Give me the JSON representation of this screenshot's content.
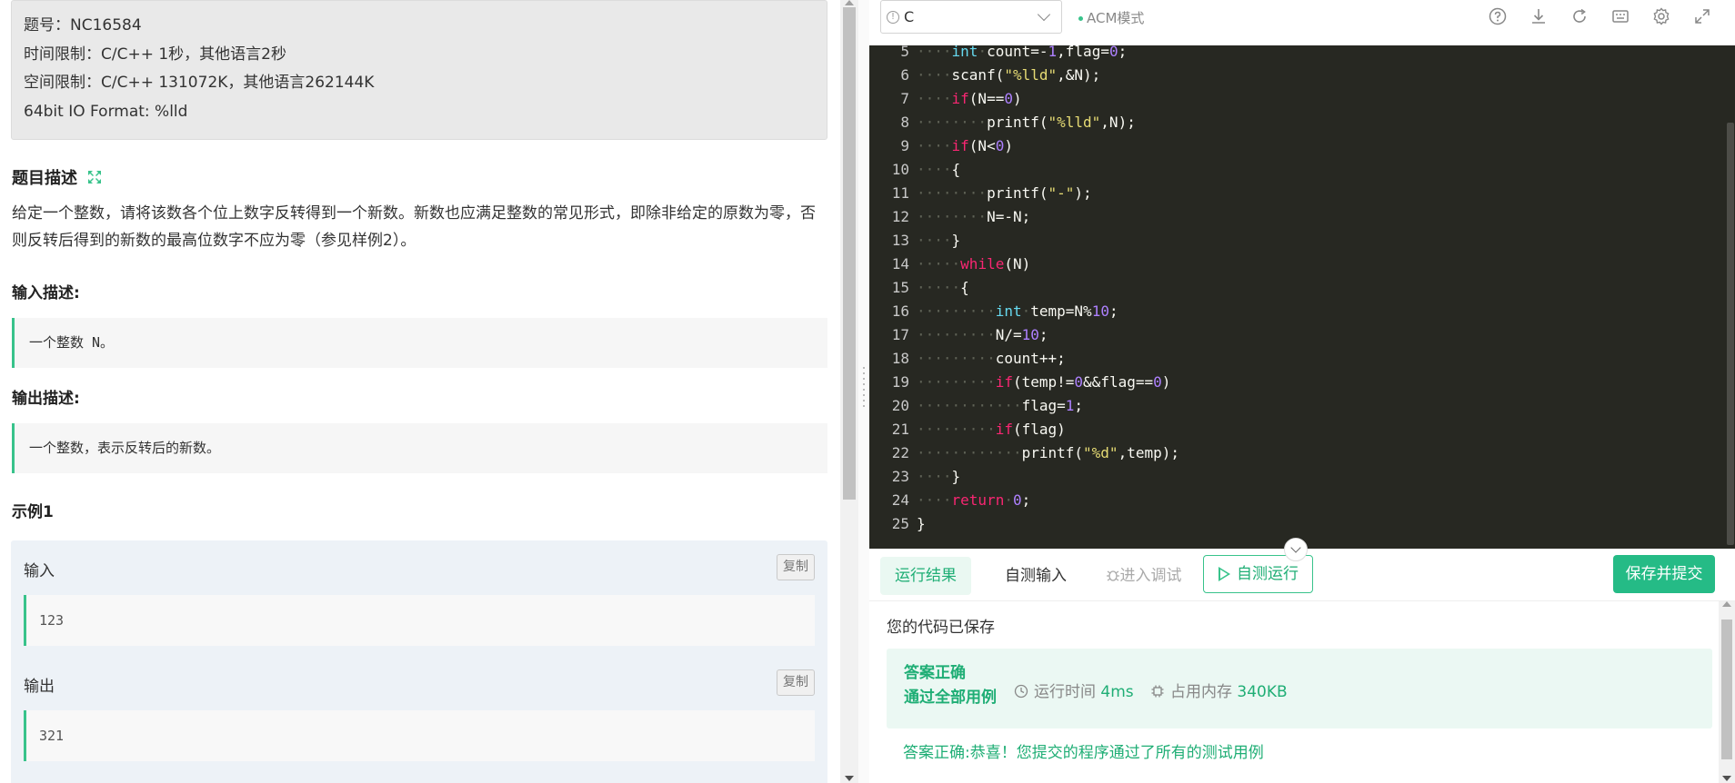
{
  "problem_info": {
    "id_line": "题号：NC16584",
    "time_limit": "时间限制：C/C++ 1秒，其他语言2秒",
    "space_limit": "空间限制：C/C++ 131072K，其他语言262144K",
    "io_format": "64bit IO Format: %lld"
  },
  "description": {
    "title": "题目描述",
    "text": "给定一个整数，请将该数各个位上数字反转得到一个新数。新数也应满足整数的常见形式，即除非给定的原数为零，否则反转后得到的新数的最高位数字不应为零（参见样例2）。"
  },
  "input_desc": {
    "title": "输入描述:",
    "text": "一个整数 N。"
  },
  "output_desc": {
    "title": "输出描述:",
    "text": "一个整数，表示反转后的新数。"
  },
  "example": {
    "title": "示例1",
    "input_label": "输入",
    "input_value": "123",
    "output_label": "输出",
    "output_value": "321",
    "copy_label": "复制"
  },
  "editor_toolbar": {
    "language": "C",
    "mode": "ACM模式",
    "icons": [
      "help-icon",
      "download-icon",
      "refresh-icon",
      "keyboard-icon",
      "settings-icon",
      "fullscreen-icon"
    ]
  },
  "code": {
    "lines": [
      {
        "n": "5",
        "html": "<span class='ws'>····</span><span class='ty'>int</span><span class='ws'>·</span>count=-<span class='num'>1</span>,flag=<span class='num'>0</span>;"
      },
      {
        "n": "6",
        "html": "<span class='ws'>····</span>scanf(<span class='str'>\"%lld\"</span>,&amp;N);"
      },
      {
        "n": "7",
        "html": "<span class='ws'>····</span><span class='kw'>if</span>(N==<span class='num'>0</span>)"
      },
      {
        "n": "8",
        "html": "<span class='ws'>········</span>printf(<span class='str'>\"%lld\"</span>,N);"
      },
      {
        "n": "9",
        "html": "<span class='ws'>····</span><span class='kw'>if</span>(N&lt;<span class='num'>0</span>)"
      },
      {
        "n": "10",
        "html": "<span class='ws'>····</span>{"
      },
      {
        "n": "11",
        "html": "<span class='ws'>········</span>printf(<span class='str'>\"-\"</span>);"
      },
      {
        "n": "12",
        "html": "<span class='ws'>········</span>N=-N;"
      },
      {
        "n": "13",
        "html": "<span class='ws'>····</span>}"
      },
      {
        "n": "14",
        "html": "<span class='ws'>·····</span><span class='kw'>while</span>(N)"
      },
      {
        "n": "15",
        "html": "<span class='ws'>·····</span>{"
      },
      {
        "n": "16",
        "html": "<span class='ws'>·········</span><span class='ty'>int</span><span class='ws'>·</span>temp=N%<span class='num'>10</span>;"
      },
      {
        "n": "17",
        "html": "<span class='ws'>·········</span>N/=<span class='num'>10</span>;"
      },
      {
        "n": "18",
        "html": "<span class='ws'>·········</span>count++;"
      },
      {
        "n": "19",
        "html": "<span class='ws'>·········</span><span class='kw'>if</span>(temp!=<span class='num'>0</span>&amp;&amp;flag==<span class='num'>0</span>)"
      },
      {
        "n": "20",
        "html": "<span class='ws'>············</span>flag=<span class='num'>1</span>;"
      },
      {
        "n": "21",
        "html": "<span class='ws'>·········</span><span class='kw'>if</span>(flag)"
      },
      {
        "n": "22",
        "html": "<span class='ws'>············</span>printf(<span class='str'>\"%d\"</span>,temp);"
      },
      {
        "n": "23",
        "html": "<span class='ws'>····</span>}"
      },
      {
        "n": "24",
        "html": "<span class='ws'>····</span><span class='kw'>return</span><span class='ws'>·</span><span class='num'>0</span>;"
      },
      {
        "n": "25",
        "html": "}"
      }
    ]
  },
  "tabs": {
    "result": "运行结果",
    "custom_input": "自测输入",
    "debug": "进入调试",
    "run": "自测运行",
    "submit": "保存并提交"
  },
  "result": {
    "saved": "您的代码已保存",
    "status_line1": "答案正确",
    "status_line2": "通过全部用例",
    "runtime_label": "运行时间",
    "runtime_value": "4ms",
    "memory_label": "占用内存",
    "memory_value": "340KB",
    "message": "答案正确:恭喜！您提交的程序通过了所有的测试用例"
  },
  "colors": {
    "accent": "#25bb86",
    "editor_bg": "#272822",
    "keyword": "#f92672",
    "type": "#66d9ef",
    "number": "#ae81ff",
    "string": "#e6db74"
  }
}
